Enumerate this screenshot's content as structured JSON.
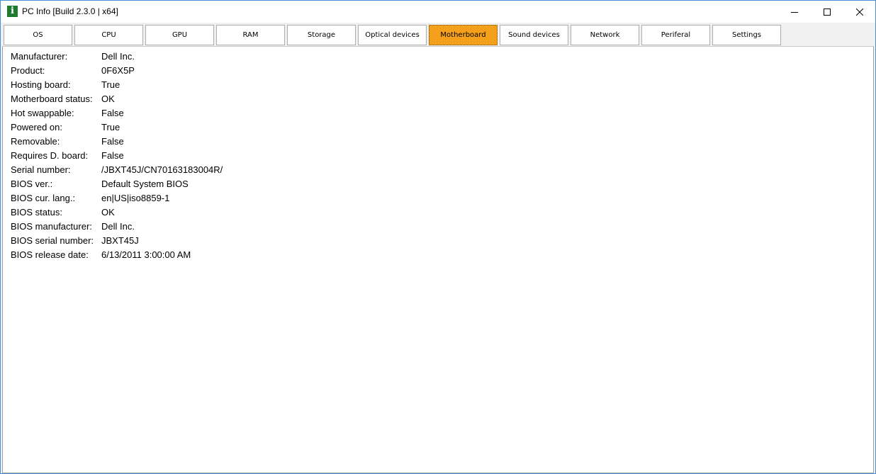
{
  "window": {
    "title": "PC Info [Build 2.3.0 | x64]",
    "icon": "info-icon",
    "controls": {
      "minimize": "minimize-icon",
      "maximize": "maximize-icon",
      "close": "close-icon"
    }
  },
  "tabs": [
    {
      "label": "OS"
    },
    {
      "label": "CPU"
    },
    {
      "label": "GPU"
    },
    {
      "label": "RAM"
    },
    {
      "label": "Storage"
    },
    {
      "label": "Optical devices"
    },
    {
      "label": "Motherboard"
    },
    {
      "label": "Sound devices"
    },
    {
      "label": "Network"
    },
    {
      "label": "Periferal"
    },
    {
      "label": "Settings"
    }
  ],
  "active_tab": "Motherboard",
  "colors": {
    "active_tab": "#f5a01a",
    "app_icon": "#1f7a2e",
    "window_border": "#4a8fd9"
  },
  "info": [
    {
      "label": "Manufacturer:",
      "value": "Dell Inc."
    },
    {
      "label": "Product:",
      "value": "0F6X5P"
    },
    {
      "label": "Hosting board:",
      "value": "True"
    },
    {
      "label": "Motherboard status:",
      "value": "OK"
    },
    {
      "label": "Hot swappable:",
      "value": "False"
    },
    {
      "label": "Powered on:",
      "value": "True"
    },
    {
      "label": "Removable:",
      "value": "False"
    },
    {
      "label": "Requires D. board:",
      "value": "False"
    },
    {
      "label": "Serial number:",
      "value": "/JBXT45J/CN70163183004R/"
    },
    {
      "label": "BIOS ver.:",
      "value": "Default System BIOS"
    },
    {
      "label": "BIOS cur. lang.:",
      "value": "en|US|iso8859-1"
    },
    {
      "label": "BIOS status:",
      "value": "OK"
    },
    {
      "label": "BIOS manufacturer:",
      "value": "Dell Inc."
    },
    {
      "label": "BIOS serial number:",
      "value": "JBXT45J"
    },
    {
      "label": "BIOS release date:",
      "value": "6/13/2011 3:00:00 AM"
    }
  ]
}
